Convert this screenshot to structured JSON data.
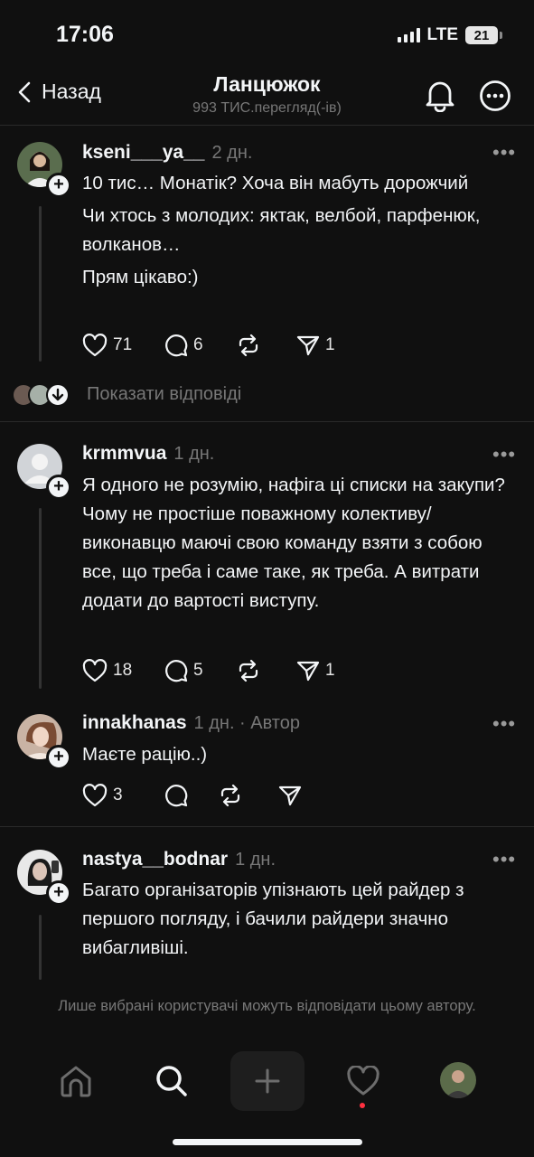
{
  "status_bar": {
    "time": "17:06",
    "network": "LTE",
    "battery": "21"
  },
  "header": {
    "back_label": "Назад",
    "title": "Ланцюжок",
    "views": "993 ТИС.перегляд(-ів)"
  },
  "posts": [
    {
      "username": "kseni___ya__",
      "time": "2 дн.",
      "paragraphs": [
        "10 тис… Монатік? Хоча він мабуть дорожчий",
        "Чи хтось з молодих: яктак, велбой, парфенюк, волканов…",
        "Прям цікаво:)"
      ],
      "likes": "71",
      "replies": "6",
      "shares": "1"
    },
    {
      "username": "krmmvua",
      "time": "1 дн.",
      "paragraphs": [
        "Я одного не розумію, нафіга ці списки на закупи? Чому не простіше поважному колективу/виконавцю маючі свою команду взяти з собою все, що треба і саме таке, як треба. А витрати додати до вартості виступу."
      ],
      "likes": "18",
      "replies": "5",
      "shares": "1"
    },
    {
      "username": "innakhanas",
      "time": "1 дн. · Автор",
      "paragraphs": [
        "Маєте рацію..)"
      ],
      "likes": "3"
    },
    {
      "username": "nastya__bodnar",
      "time": "1 дн.",
      "paragraphs": [
        "Багато організаторів упізнають цей райдер з першого погляду, і бачили райдери значно вибагливіші."
      ]
    }
  ],
  "show_replies_label": "Показати відповіді",
  "more_label": "•••",
  "footer_note": "Лише вибрані користувачі можуть відповідати цьому автору.",
  "colors": {
    "background": "#101010",
    "text": "#f3f5f7",
    "muted": "#777777",
    "divider": "#2a2a2a",
    "notification_dot": "#ff3040"
  },
  "bottom_nav": [
    "home-icon",
    "search-icon",
    "create-icon",
    "heart-icon",
    "profile-avatar"
  ]
}
